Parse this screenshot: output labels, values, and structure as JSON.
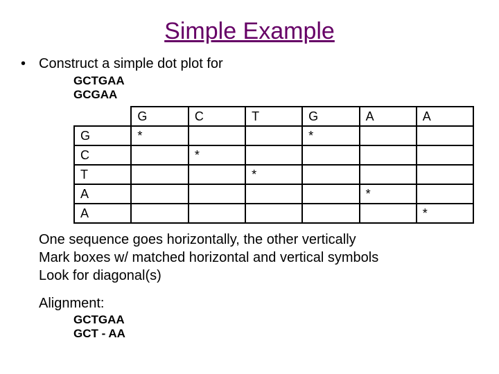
{
  "title": "Simple Example",
  "bullet": "Construct a simple dot plot for",
  "seq1": "GCTGAA",
  "seq2": "GCGAA",
  "table": {
    "cols": [
      "G",
      "C",
      "T",
      "G",
      "A",
      "A"
    ],
    "rows": [
      "G",
      "C",
      "T",
      "A",
      "A"
    ],
    "marks": {
      "r0c0": "*",
      "r0c3": "*",
      "r1c1": "*",
      "r2c2": "*",
      "r3c4": "*",
      "r4c5": "*"
    }
  },
  "explain1": "One sequence goes horizontally, the other vertically",
  "explain2": "Mark boxes w/ matched horizontal and vertical symbols",
  "explain3": "Look for diagonal(s)",
  "alignment_label": "Alignment:",
  "align1": "GCTGAA",
  "align2": "GCT - AA"
}
